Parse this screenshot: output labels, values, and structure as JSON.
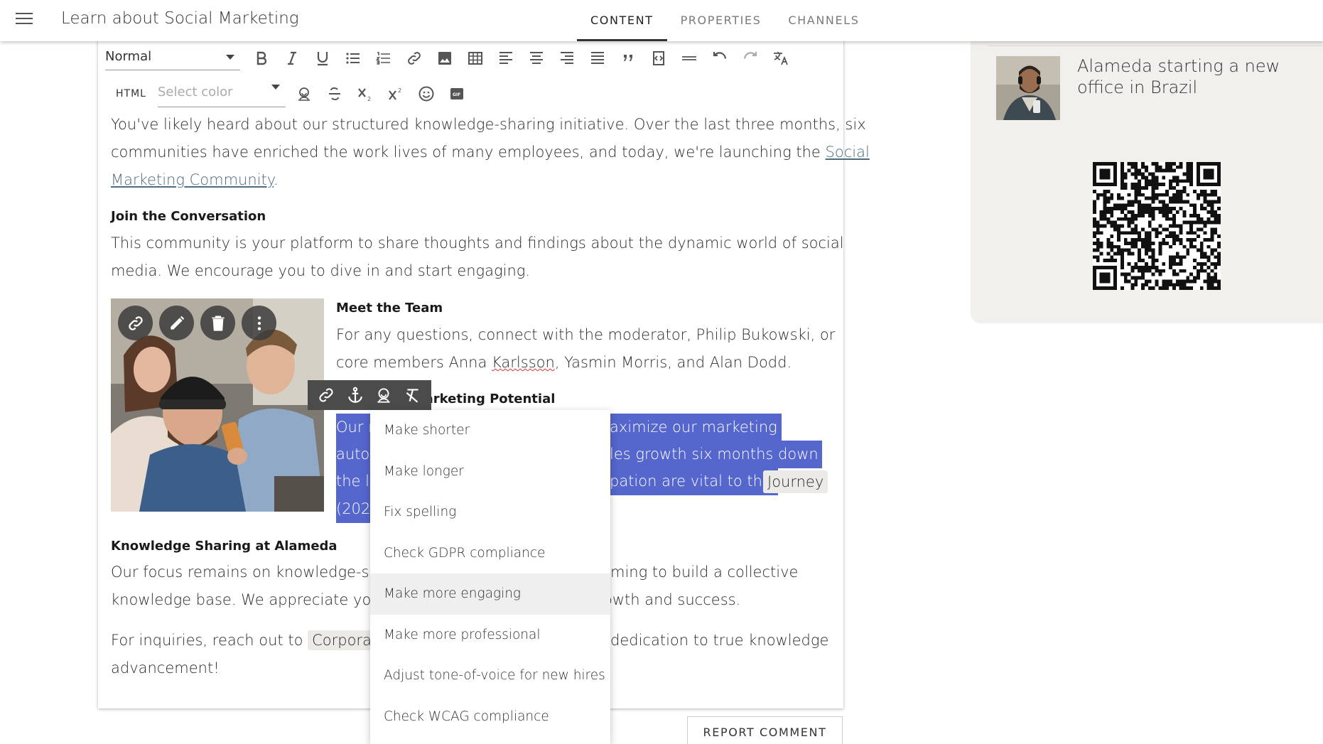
{
  "header": {
    "title": "Learn about Social Marketing",
    "tabs": [
      {
        "label": "CONTENT",
        "active": true
      },
      {
        "label": "PROPERTIES",
        "active": false
      },
      {
        "label": "CHANNELS",
        "active": false
      }
    ]
  },
  "sidebar_news": {
    "title": "Alameda starting a new office in Brazil"
  },
  "toolbar": {
    "format_value": "Normal",
    "html_label": "HTML",
    "color_placeholder": "Select color",
    "icons": [
      "bold-icon",
      "italic-icon",
      "underline-icon",
      "bullet-list-icon",
      "numbered-list-icon",
      "link-icon",
      "image-icon",
      "table-icon",
      "align-left-icon",
      "align-center-icon",
      "align-right-icon",
      "justify-icon",
      "quote-icon",
      "code-block-icon",
      "horizontal-rule-icon",
      "undo-icon",
      "redo-icon",
      "translate-icon"
    ]
  },
  "article": {
    "p1_line1": "You've likely heard about our structured knowledge-sharing initiative. Over the last three months, six",
    "p1_line2_pre": "communities have enriched the work lives of many employees, and today, we're launching the ",
    "p1_link_part1": "Social",
    "p1_link_part2": "Marketing Community",
    "p1_end": ".",
    "h_join": "Join the Conversation",
    "p2_line1": "This community is your platform to share thoughts and findings about the dynamic world of social",
    "p2_line2": "media. We encourage you to dive in and start engaging.",
    "h_team": "Meet the Team",
    "p3_line1": "For any questions, connect with the moderator, Philip Bukowski, or",
    "p3_line2_pre": "core members Anna ",
    "p3_line2_name": "Karlsson",
    "p3_line2_post": ", Yasmin Morris, and Alan Dodd.",
    "h_unlock": "Unlocking Marketing Potential",
    "sel_l1_left": "Our r",
    "sel_l1_right": "aximize our marketing",
    "sel_l2_left": "autor",
    "sel_l2_right": "les growth six months down",
    "sel_l3_left": "the li",
    "sel_l3_right": "pation are vital to this",
    "sel_l3_chip": "Journey",
    "sel_l4_left": "(2024",
    "h_knowledge": "Knowledge Sharing at Alameda",
    "p5_l1_left": "Our focus remains on knowledge-sha",
    "p5_l1_right": "ming to build a collective",
    "p5_l2_left": "knowledge base. We appreciate your",
    "p5_l2_right": "owth and success.",
    "p6_l1_pre": "For inquiries, reach out to ",
    "p6_chip": "Corporate",
    "p6_l1_right": "dedication to true knowledge",
    "p6_l2": "advancement!"
  },
  "ai_menu": {
    "items": [
      "Make shorter",
      "Make longer",
      "Fix spelling",
      "Check GDPR compliance",
      "Make more engaging",
      "Make more professional",
      "Adjust tone-of-voice for new hires",
      "Check WCAG compliance"
    ],
    "hovered_index": 4
  },
  "footer": {
    "report_label": "REPORT COMMENT"
  },
  "colors": {
    "selection": "#5566cc",
    "link": "#4d6c80",
    "panel_bg": "#f1f0ed"
  }
}
